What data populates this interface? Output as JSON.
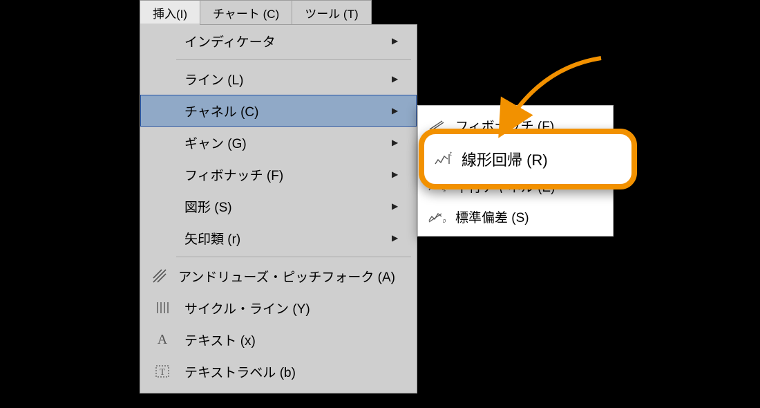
{
  "menubar": {
    "items": [
      {
        "label": "挿入(I)",
        "active": true
      },
      {
        "label": "チャート (C)",
        "active": false
      },
      {
        "label": "ツール (T)",
        "active": false
      }
    ]
  },
  "menu": {
    "items": [
      {
        "label": "インディケータ",
        "icon": "",
        "arrow": true
      },
      {
        "sep": true
      },
      {
        "label": "ライン (L)",
        "icon": "",
        "arrow": true
      },
      {
        "label": "チャネル (C)",
        "icon": "",
        "arrow": true,
        "highlight": true
      },
      {
        "label": "ギャン (G)",
        "icon": "",
        "arrow": true
      },
      {
        "label": "フィボナッチ (F)",
        "icon": "",
        "arrow": true
      },
      {
        "label": "図形 (S)",
        "icon": "",
        "arrow": true
      },
      {
        "label": "矢印類 (r)",
        "icon": "",
        "arrow": true
      },
      {
        "sep": true
      },
      {
        "label": "アンドリューズ・ピッチフォーク (A)",
        "icon": "pitchfork",
        "arrow": false
      },
      {
        "label": "サイクル・ライン (Y)",
        "icon": "cycle",
        "arrow": false
      },
      {
        "label": "テキスト (x)",
        "icon": "text-a",
        "arrow": false
      },
      {
        "label": "テキストラベル (b)",
        "icon": "text-label",
        "arrow": false
      }
    ]
  },
  "submenu": {
    "items": [
      {
        "label": "フィボナッチ (F)",
        "icon": "fib-ch"
      },
      {
        "label": "線形回帰 (R)",
        "icon": "linreg",
        "callout": true
      },
      {
        "label": "平行チャネル (E)",
        "icon": "equi"
      },
      {
        "label": "標準偏差 (S)",
        "icon": "stdev"
      }
    ]
  },
  "colors": {
    "highlight_orange": "#f29100",
    "menu_bg": "#cfcfcf",
    "highlight_row": "#90a9c7"
  }
}
